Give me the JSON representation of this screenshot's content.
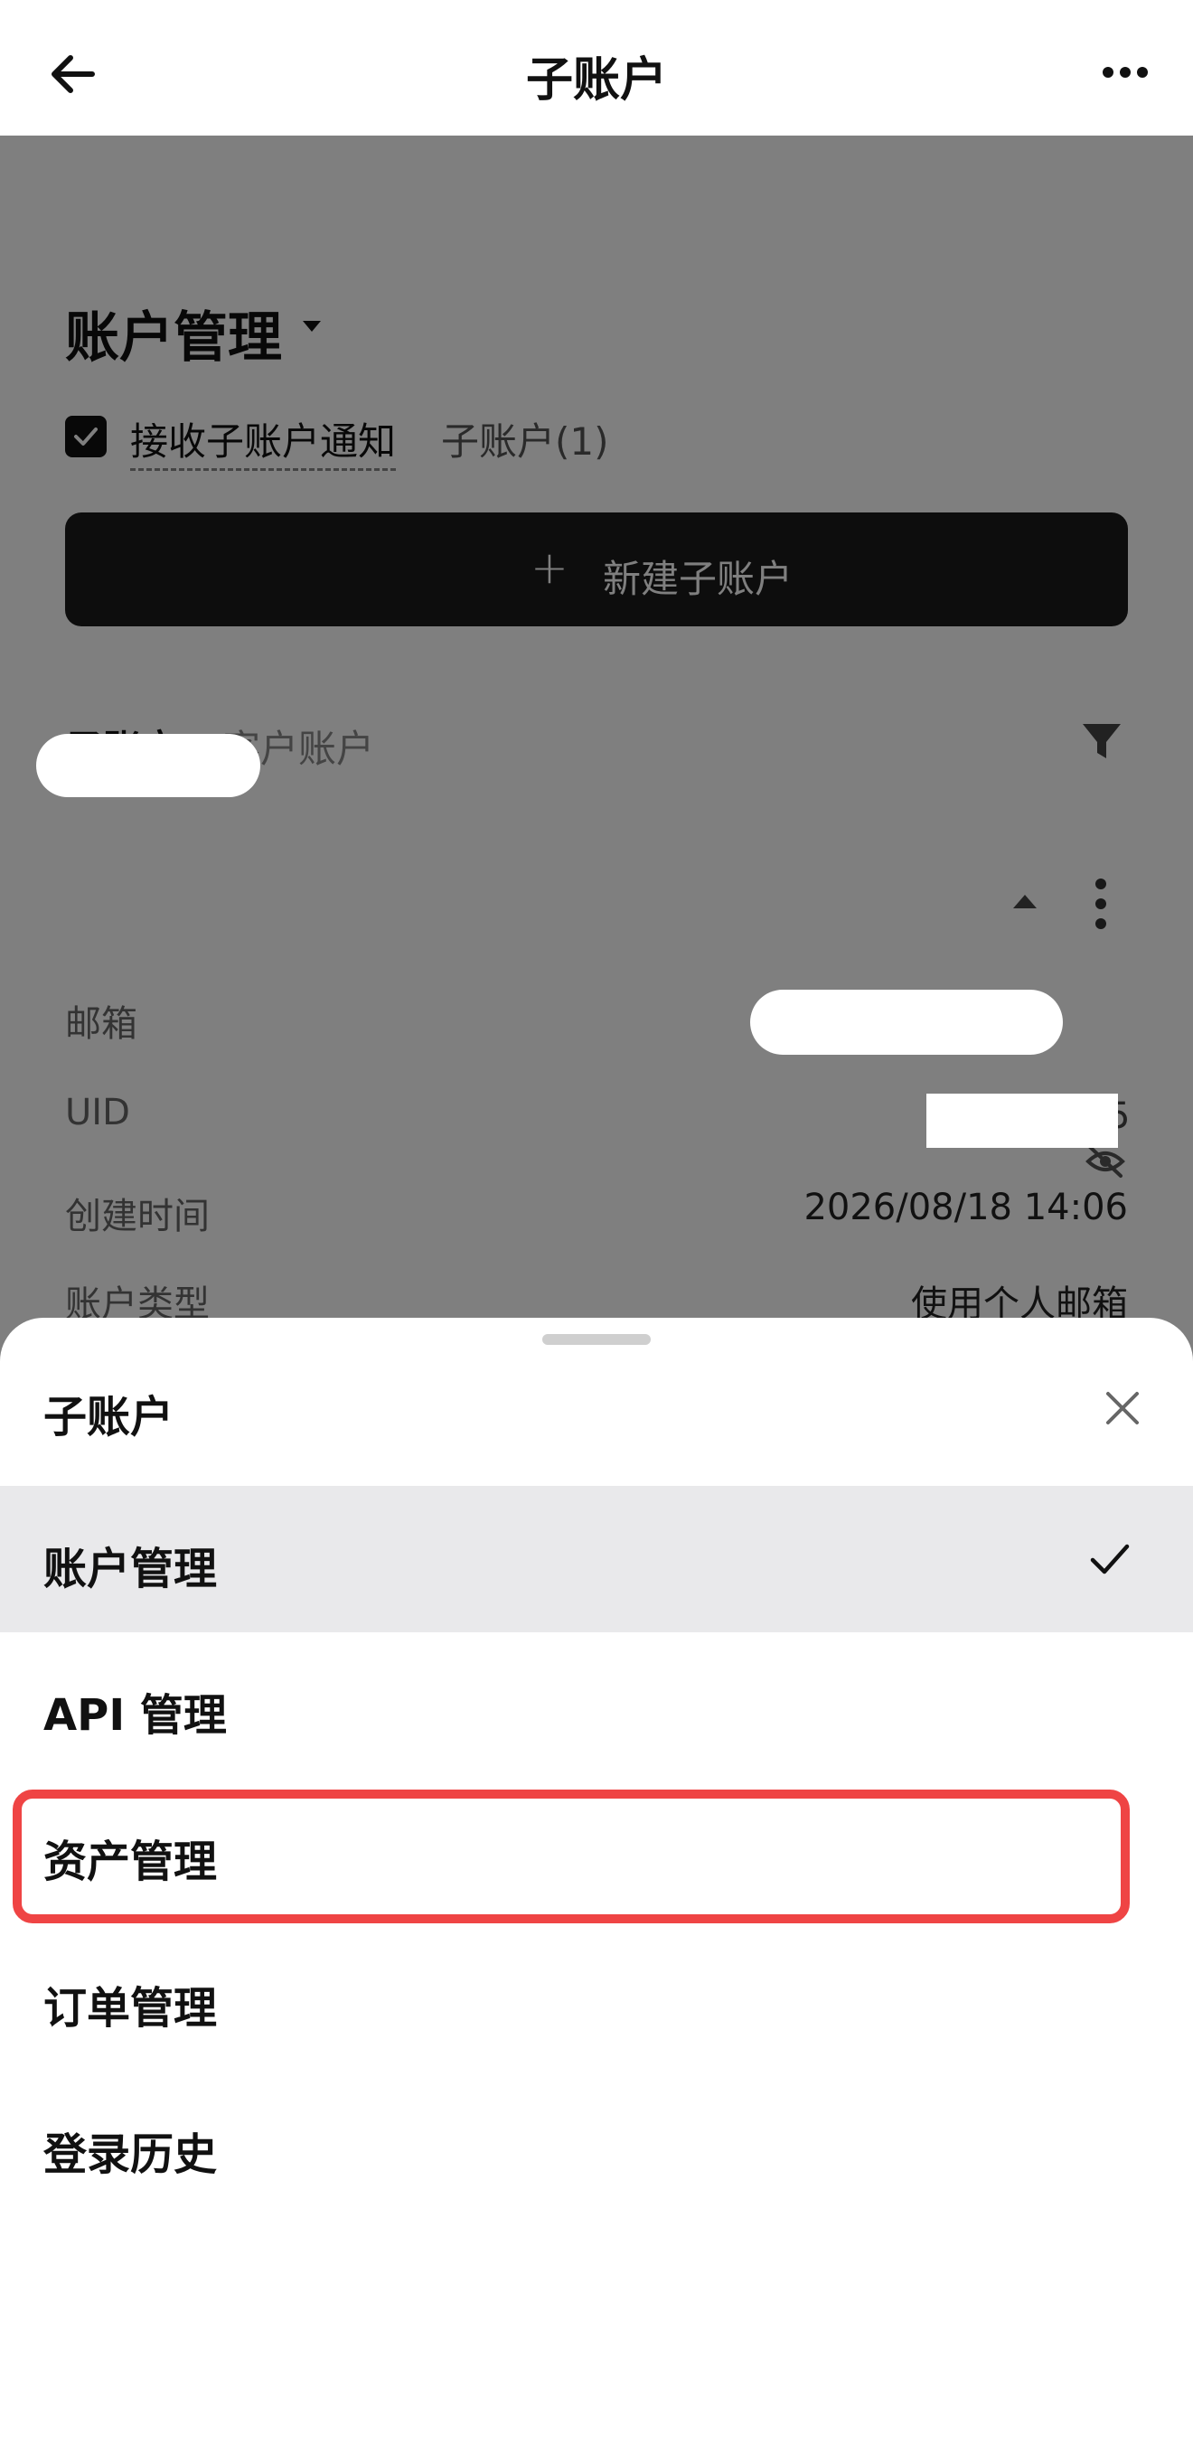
{
  "header": {
    "title": "子账户",
    "back_icon": "arrow-left-icon",
    "more_icon": "more-horizontal-icon"
  },
  "page": {
    "section_title": "账户管理",
    "notify_label": "接收子账户通知",
    "subaccount_count": "子账户(1)",
    "new_button": {
      "plus": "+",
      "label": "新建子账户"
    },
    "tabs": [
      {
        "label": "子账户",
        "active": true
      },
      {
        "label": "客户账户",
        "active": false
      }
    ],
    "card": {
      "rows": [
        {
          "label": "邮箱",
          "value": ""
        },
        {
          "label": "UID",
          "value": "5"
        },
        {
          "label": "创建时间",
          "value": "2026/08/18 14:06"
        },
        {
          "label": "账户类型",
          "value": "使用个人邮箱"
        }
      ]
    }
  },
  "sheet": {
    "title": "子账户",
    "items": [
      {
        "label": "账户管理",
        "selected": true
      },
      {
        "label": "API 管理",
        "selected": false
      },
      {
        "label": "资产管理",
        "selected": false
      },
      {
        "label": "订单管理",
        "selected": false
      },
      {
        "label": "登录历史",
        "selected": false
      }
    ]
  },
  "colors": {
    "highlight": "#ef4444",
    "selected_bg": "#e9e9eb",
    "overlay": "rgba(0,0,0,0.5)",
    "button_bg": "#1a1a1a"
  }
}
